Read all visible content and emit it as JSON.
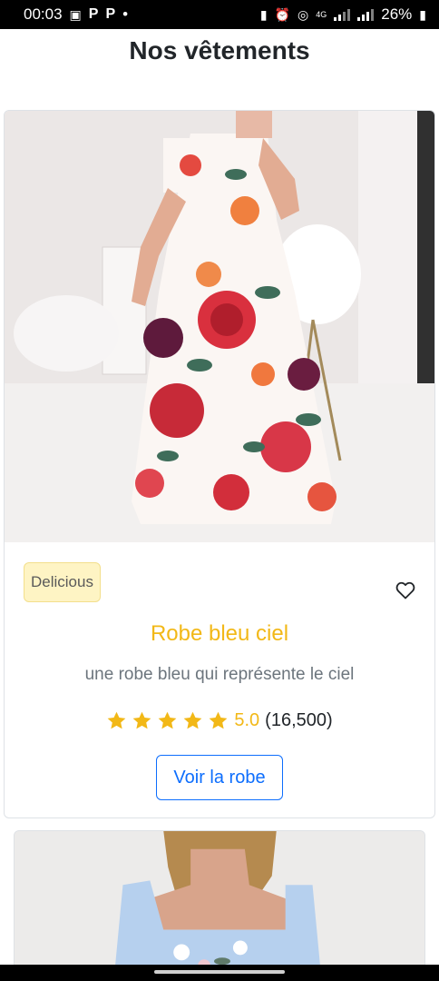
{
  "status_bar": {
    "time": "00:03",
    "notif_p1": "P",
    "notif_p2": "P",
    "dot": "•",
    "net": "4G",
    "battery": "26%"
  },
  "page": {
    "title": "Nos vêtements"
  },
  "product": {
    "badge": "Delicious",
    "name": "Robe bleu ciel",
    "description": "une robe bleu qui représente le ciel",
    "rating_value": "5.0",
    "rating_count": "(16,500)",
    "stars_filled": 5,
    "stars_total": 5,
    "button_label": "Voir la robe",
    "icons": {
      "favorite": "heart-outline-icon",
      "star": "star-icon"
    }
  },
  "colors": {
    "accent": "#f2b817",
    "primary": "#0d6efd",
    "badge_bg": "#fef4c4",
    "muted": "#6c757d"
  }
}
